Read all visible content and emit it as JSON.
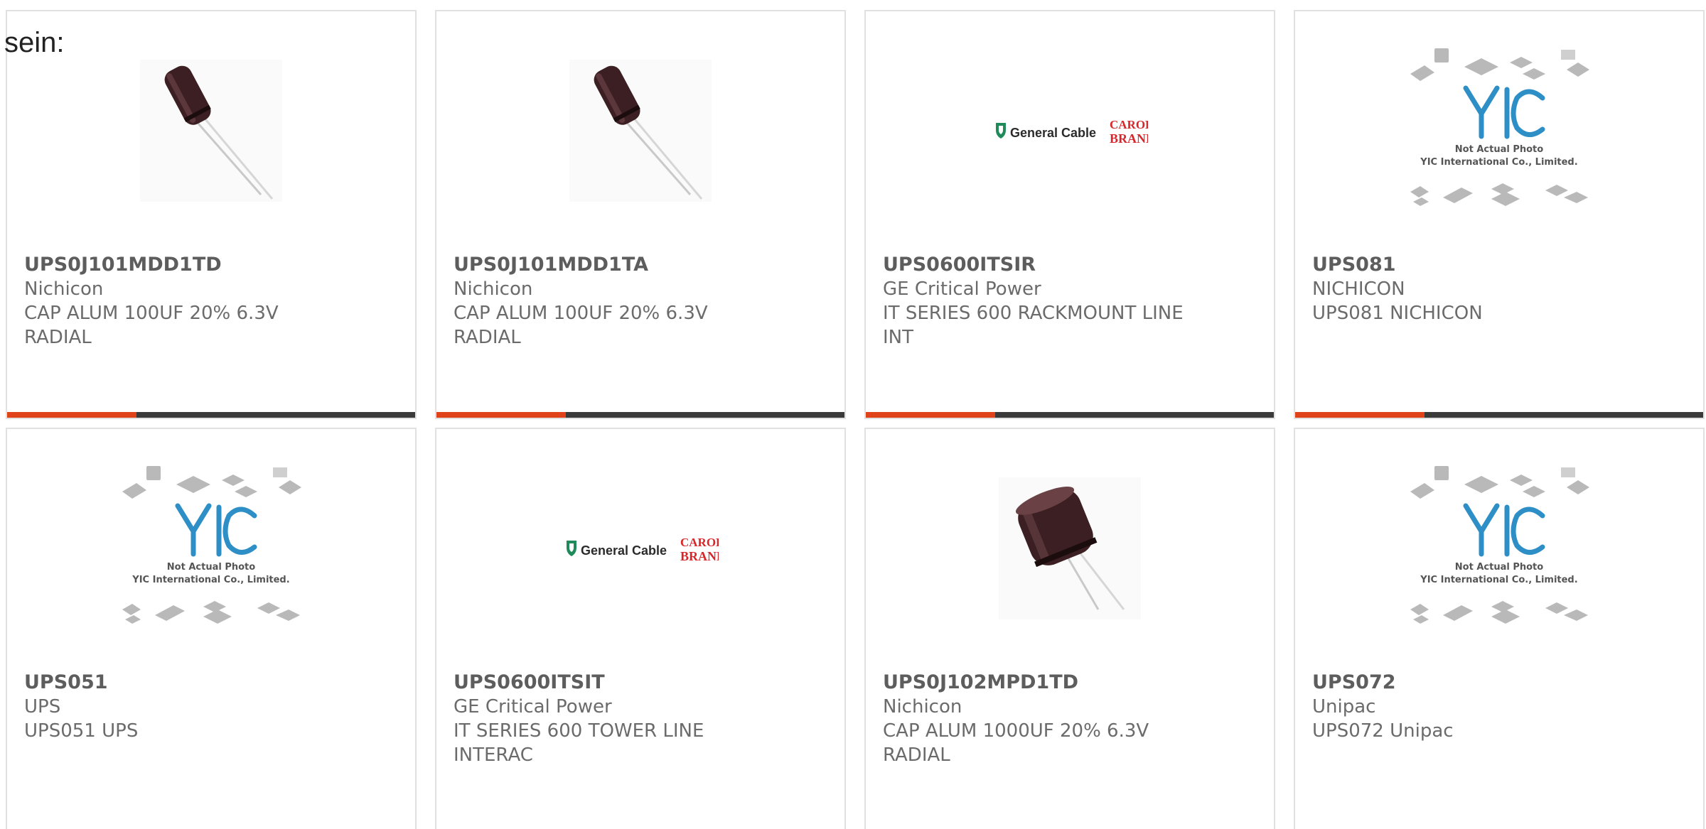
{
  "intro_text": "sein:",
  "colors": {
    "accent": "#e0421a",
    "bar_dark": "#3a3a3a",
    "border": "#e1e1e1",
    "text": "#6b6b6b"
  },
  "placeholder_image": {
    "line1": "Not Actual Photo",
    "line2": "YIC International Co., Limited."
  },
  "brand_logo": {
    "left": "General Cable",
    "right_top": "CAROL",
    "right_bottom": "BRAND"
  },
  "products": [
    {
      "part_number": "UPS0J101MDD1TD",
      "manufacturer": "Nichicon",
      "description_line1": "CAP ALUM 100UF 20% 6.3V",
      "description_line2": "RADIAL",
      "image_icon": "capacitor-image"
    },
    {
      "part_number": "UPS0J101MDD1TA",
      "manufacturer": "Nichicon",
      "description_line1": "CAP ALUM 100UF 20% 6.3V",
      "description_line2": "RADIAL",
      "image_icon": "capacitor-image"
    },
    {
      "part_number": "UPS0600ITSIR",
      "manufacturer": "GE Critical Power",
      "description_line1": "IT SERIES 600 RACKMOUNT LINE",
      "description_line2": "INT",
      "image_icon": "brand-logo-image"
    },
    {
      "part_number": "UPS081",
      "manufacturer": "NICHICON",
      "description_line1": "UPS081 NICHICON",
      "description_line2": "",
      "image_icon": "placeholder-image"
    },
    {
      "part_number": "UPS051",
      "manufacturer": "UPS",
      "description_line1": "UPS051 UPS",
      "description_line2": "",
      "image_icon": "placeholder-image"
    },
    {
      "part_number": "UPS0600ITSIT",
      "manufacturer": "GE Critical Power",
      "description_line1": "IT SERIES 600 TOWER LINE",
      "description_line2": "INTERAC",
      "image_icon": "brand-logo-image"
    },
    {
      "part_number": "UPS0J102MPD1TD",
      "manufacturer": "Nichicon",
      "description_line1": "CAP ALUM 1000UF 20% 6.3V",
      "description_line2": "RADIAL",
      "image_icon": "capacitor-image"
    },
    {
      "part_number": "UPS072",
      "manufacturer": "Unipac",
      "description_line1": "UPS072 Unipac",
      "description_line2": "",
      "image_icon": "placeholder-image"
    }
  ]
}
